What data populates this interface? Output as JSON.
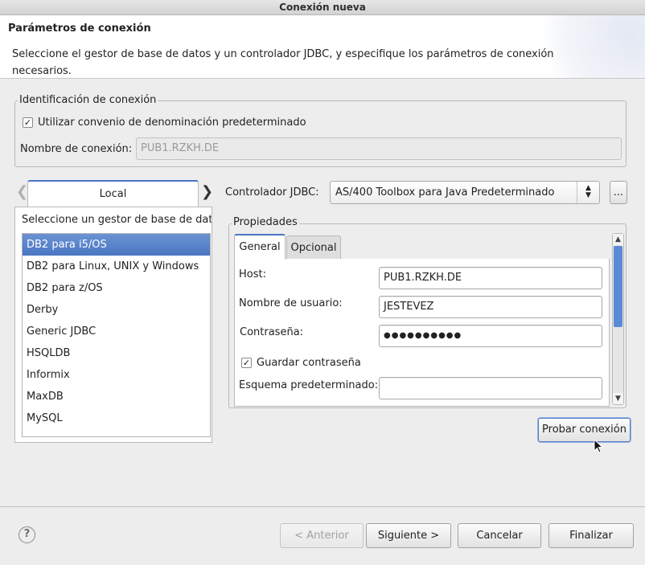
{
  "window": {
    "title": "Conexión nueva"
  },
  "banner": {
    "title": "Parámetros de conexión",
    "description": "Seleccione el gestor de base de datos y un controlador JDBC, y especifique los parámetros de conexión necesarios."
  },
  "identification": {
    "legend": "Identificación de conexión",
    "use_default_naming": {
      "label": "Utilizar convenio de denominación predeterminado",
      "checked": true
    },
    "name_label": "Nombre de conexión:",
    "name_value": "PUB1.RZKH.DE"
  },
  "db_tabs": {
    "prev_icon": "chevron-left-icon",
    "next_icon": "chevron-right-icon",
    "active_tab": "Local"
  },
  "db_panel": {
    "header": "Seleccione un gestor de base de datos",
    "items": [
      "DB2 para i5/OS",
      "DB2 para Linux, UNIX y Windows",
      "DB2 para z/OS",
      "Derby",
      "Generic JDBC",
      "HSQLDB",
      "Informix",
      "MaxDB",
      "MySQL"
    ],
    "selected_index": 0
  },
  "jdbc": {
    "label": "Controlador JDBC:",
    "selected": "AS/400 Toolbox para Java Predeterminado",
    "browse_label": "..."
  },
  "properties": {
    "legend": "Propiedades",
    "tabs": [
      "General",
      "Opcional"
    ],
    "active_tab": "General",
    "host_label": "Host:",
    "host_value": "PUB1.RZKH.DE",
    "user_label": "Nombre de usuario:",
    "user_value": "JESTEVEZ",
    "password_label": "Contraseña:",
    "password_value": "●●●●●●●●●●",
    "save_password": {
      "label": "Guardar contraseña",
      "checked": true
    },
    "schema_label": "Esquema predeterminado:",
    "schema_value": ""
  },
  "test_button": "Probar conexión",
  "footer": {
    "help_icon": "help-icon",
    "back": "< Anterior",
    "next": "Siguiente >",
    "cancel": "Cancelar",
    "finish": "Finalizar"
  },
  "colors": {
    "selection": "#4a75c2",
    "accent": "#4a74c3"
  }
}
